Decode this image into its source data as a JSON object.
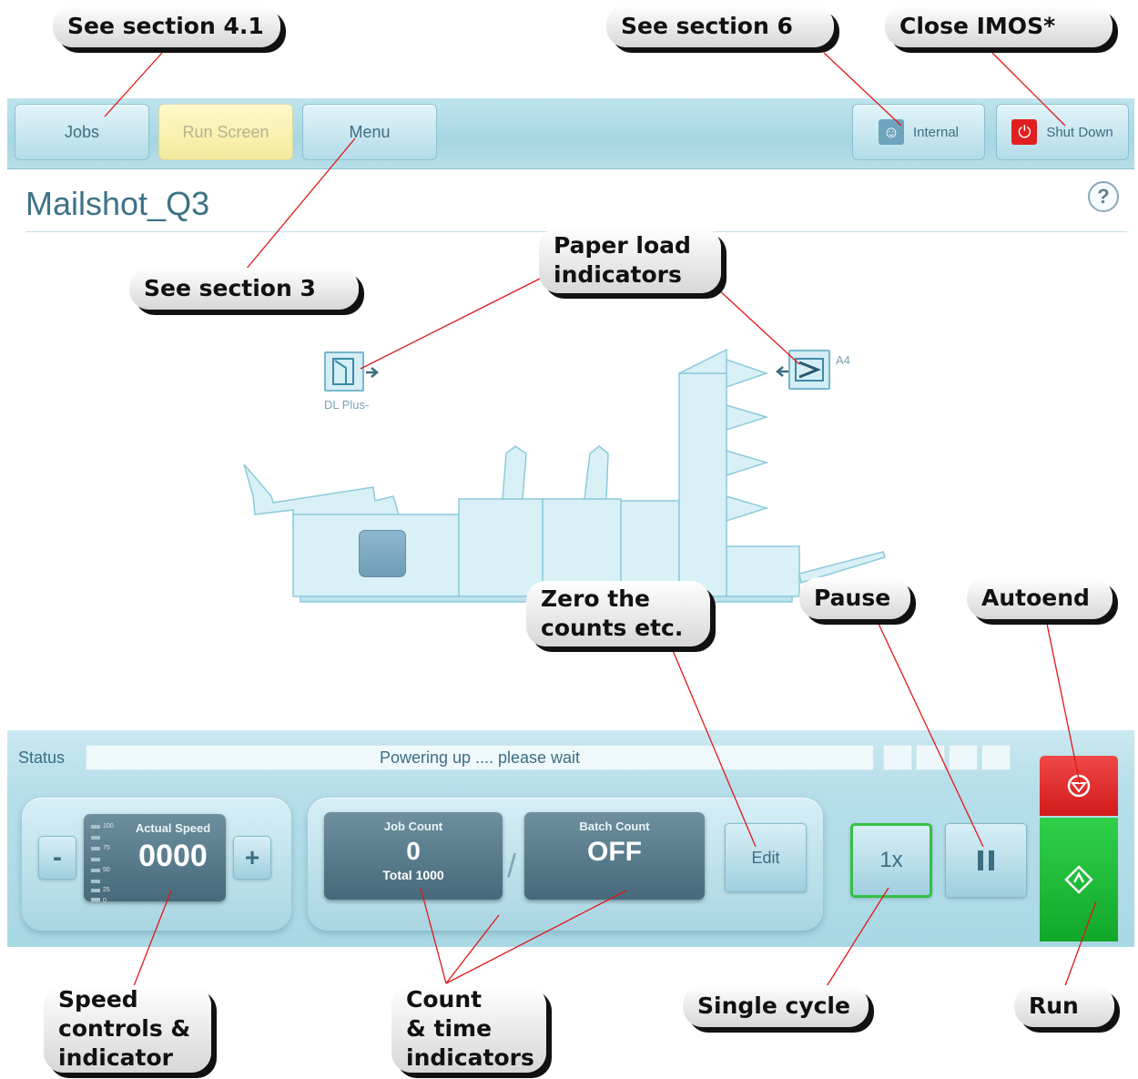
{
  "nav": {
    "jobs": "Jobs",
    "run_screen": "Run Screen",
    "menu": "Menu",
    "internal": "Internal",
    "shut_down": "Shut Down"
  },
  "job_title": "Mailshot_Q3",
  "help": "?",
  "feeders": {
    "left_label": "DL Plus-",
    "right_label": "A4"
  },
  "status": {
    "label": "Status",
    "message": "Powering up .... please wait"
  },
  "speed": {
    "minus": "-",
    "plus": "+",
    "label": "Actual Speed",
    "value": "0000",
    "scale": [
      "100",
      "75",
      "50",
      "25",
      "0"
    ]
  },
  "counts": {
    "job_label": "Job Count",
    "job_value": "0",
    "total": "Total 1000",
    "separator": "/",
    "batch_label": "Batch Count",
    "batch_value": "OFF",
    "edit": "Edit"
  },
  "controls": {
    "single_cycle": "1x",
    "pause_symbol": "II"
  },
  "callouts": {
    "section_4_1": "See section 4.1",
    "section_6": "See section 6",
    "close_imos": "Close IMOS*",
    "section_3": "See section 3",
    "paper_load_1": "Paper load",
    "paper_load_2": "indicators",
    "zero_1": "Zero the",
    "zero_2": "counts etc.",
    "pause": "Pause",
    "autoend": "Autoend",
    "speed_1": "Speed",
    "speed_2": "controls &",
    "speed_3": "indicator",
    "count_1": "Count",
    "count_2": "& time",
    "count_3": "indicators",
    "single_cycle": "Single cycle",
    "run": "Run"
  },
  "colors": {
    "accent": "#3d7287",
    "autoend_red": "#e02020",
    "run_green": "#1cbf36",
    "active_tab": "#f3ea9d"
  }
}
